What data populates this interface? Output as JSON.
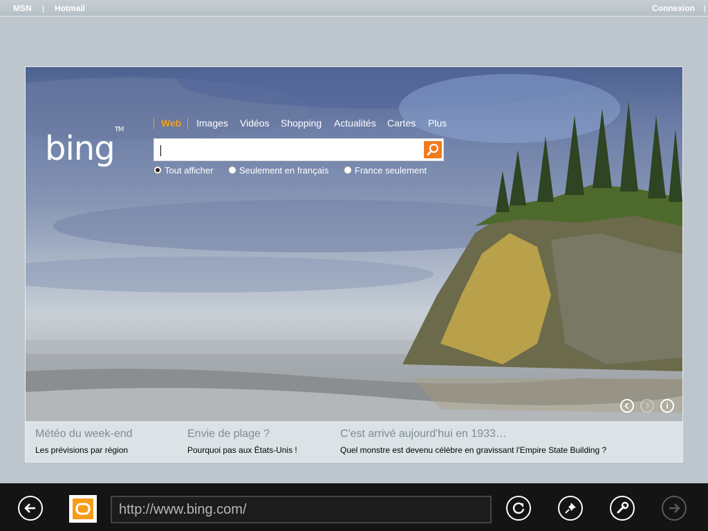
{
  "topbar": {
    "msn": "MSN",
    "separator": "|",
    "hotmail": "Hotmail",
    "connexion": "Connexion"
  },
  "logo": {
    "text": "bing",
    "tm": "TM"
  },
  "nav": {
    "web": "Web",
    "images": "Images",
    "videos": "Vidéos",
    "shopping": "Shopping",
    "actualites": "Actualités",
    "cartes": "Cartes",
    "plus": "Plus"
  },
  "search": {
    "value": ""
  },
  "radios": [
    {
      "label": "Tout afficher",
      "selected": true
    },
    {
      "label": "Seulement en français",
      "selected": false
    },
    {
      "label": "France seulement",
      "selected": false
    }
  ],
  "hero_controls": {
    "info": "i"
  },
  "news": [
    {
      "heading": "Météo du week-end",
      "sub": "Les prévisions par région"
    },
    {
      "heading": "Envie de plage ?",
      "sub": "Pourquoi pas aux États-Unis !"
    },
    {
      "heading": "C'est arrivé aujourd'hui en 1933…",
      "sub": "Quel monstre est devenu célèbre en gravissant l'Empire State Building ?"
    }
  ],
  "appbar": {
    "url": "http://www.bing.com/"
  },
  "colors": {
    "accent_orange": "#f07b1e",
    "favicon_orange": "#f59d19",
    "appbar_bg": "#141414"
  }
}
